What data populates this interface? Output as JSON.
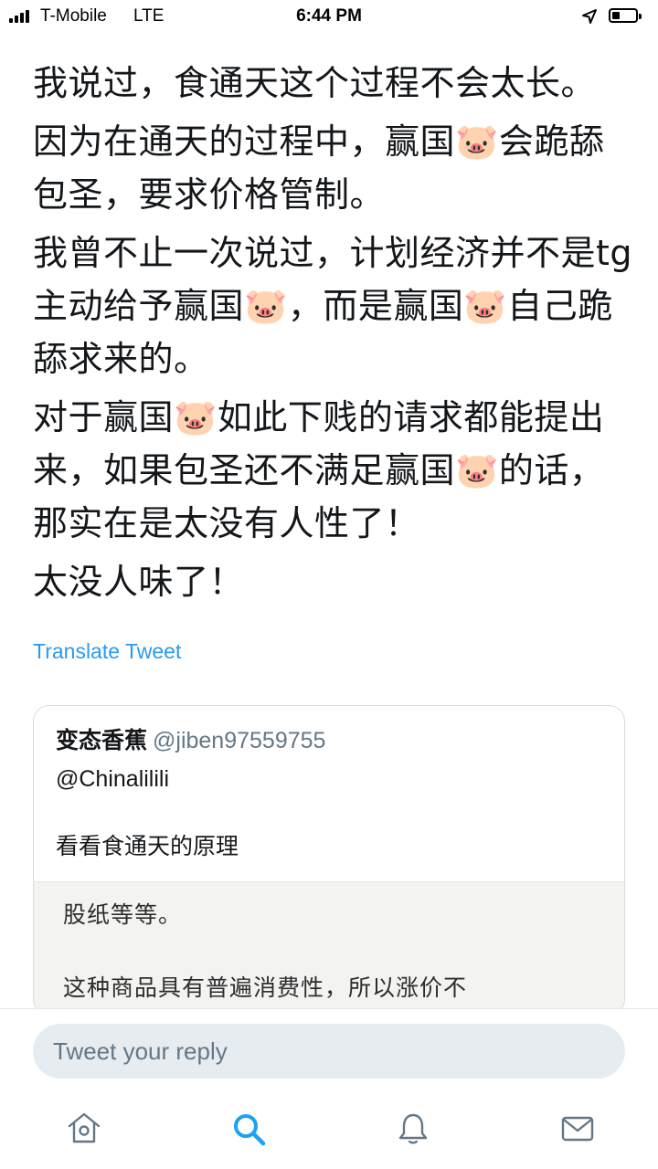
{
  "status_bar": {
    "carrier": "T-Mobile",
    "network": "LTE",
    "time": "6:44 PM"
  },
  "tweet": {
    "paragraphs": [
      "我说过，食通天这个过程不会太长。",
      "因为在通天的过程中，赢国🐷会跪舔包圣，要求价格管制。",
      "我曾不止一次说过，计划经济并不是tg主动给予赢国🐷，而是赢国🐷自己跪舔求来的。",
      "对于赢国🐷如此下贱的请求都能提出来，如果包圣还不满足赢国🐷的话，那实在是太没有人性了！",
      "太没人味了！"
    ],
    "translate_label": "Translate Tweet"
  },
  "quote": {
    "name": "变态香蕉",
    "handle": "@jiben97559755",
    "mention": "@Chinalilili",
    "text": "看看食通天的原理",
    "image_lines": [
      "股纸等等。",
      "这种商品具有普遍消费性，所以涨价不"
    ]
  },
  "reply": {
    "placeholder": "Tweet your reply"
  },
  "colors": {
    "link": "#2b9af0",
    "active_tab": "#1da1f2",
    "inactive_tab": "#657786"
  },
  "tabs": [
    "home-icon",
    "search-icon",
    "notifications-icon",
    "messages-icon"
  ]
}
